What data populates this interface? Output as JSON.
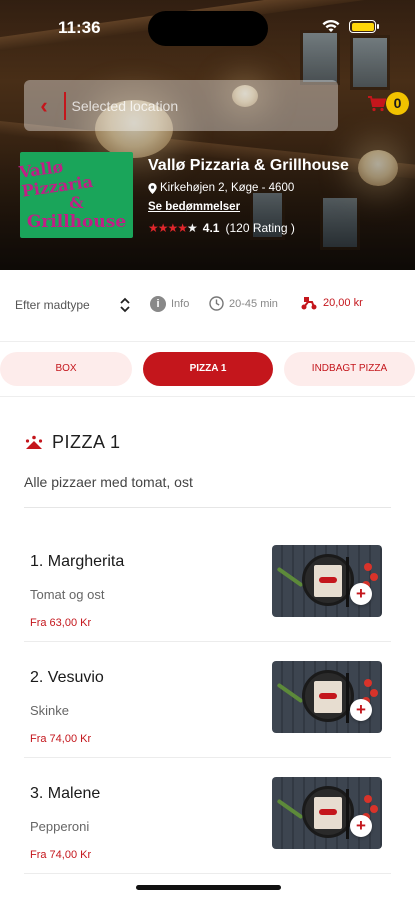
{
  "status_bar": {
    "time": "11:36"
  },
  "search": {
    "placeholder": "Selected location"
  },
  "cart": {
    "count": "0"
  },
  "restaurant": {
    "logo_lines": [
      "Vallø Pizzaria",
      "&",
      "Grillhouse"
    ],
    "name": "Vallø Pizzaria & Grillhouse",
    "address": "Kirkehøjen 2, Køge - 4600",
    "reviews_link": "Se bedømmelser",
    "rating_value": "4.1",
    "rating_count": "(120 Rating )",
    "stars_filled": 4,
    "stars_total": 5
  },
  "info_bar": {
    "sort_label": "Efter madtype",
    "info_label": "Info",
    "time_label": "20-45 min",
    "delivery_label": "20,00 kr"
  },
  "tabs": [
    {
      "label": "BOX",
      "active": false
    },
    {
      "label": "PIZZA 1",
      "active": true
    },
    {
      "label": "INDBAGT PIZZA",
      "active": false
    }
  ],
  "section": {
    "title": "PIZZA 1",
    "description": "Alle pizzaer med tomat, ost"
  },
  "items": [
    {
      "name": "1. Margherita",
      "description": "Tomat og ost",
      "price": "Fra 63,00 Kr"
    },
    {
      "name": "2. Vesuvio",
      "description": "Skinke",
      "price": "Fra 74,00 Kr"
    },
    {
      "name": "3. Malene",
      "description": "Pepperoni",
      "price": "Fra 74,00 Kr"
    }
  ],
  "colors": {
    "accent": "#c4161c",
    "badge": "#f2c200",
    "logo_bg": "#1aa55a",
    "logo_text": "#c01f86"
  }
}
